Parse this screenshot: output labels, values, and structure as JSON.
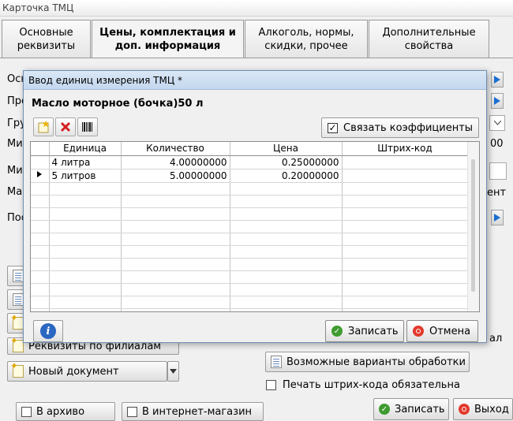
{
  "window": {
    "title": "Карточка ТМЦ"
  },
  "tabs": [
    {
      "label": "Основные\nреквизиты"
    },
    {
      "label": "Цены, комплектация и\nдоп.  информация"
    },
    {
      "label": "Алкоголь, нормы,\nскидки, прочее"
    },
    {
      "label": "Дополнительные\nсвойства"
    }
  ],
  "background": {
    "fragments": [
      "Осн",
      "Про",
      "Гру",
      "Ми",
      "Ми",
      "Ма",
      "Пос"
    ],
    "right_fragments": [
      "ент",
      "00",
      "ал"
    ],
    "buttons": {
      "branch_requisites": "Реквизиты по филиалам",
      "new_document": "Новый документ",
      "processing_variants": "Возможные варианты обработки",
      "archive": "В архиво",
      "online_store": "В интернет-магазин",
      "save": "Записать",
      "exit": "Выход"
    },
    "barcode_required": "Печать штрих-кода обязательна"
  },
  "modal": {
    "title": "Ввод единиц измерения ТМЦ *",
    "heading": "Масло моторное (бочка)50 л",
    "link_coefficients": {
      "label": "Связать коэффициенты",
      "checked": true
    },
    "columns": [
      "Единица",
      "Количество",
      "Цена",
      "Штрих-код"
    ],
    "rows": [
      {
        "unit": "4 литра",
        "qty": "4.00000000",
        "price": "0.25000000",
        "barcode": "",
        "current": false
      },
      {
        "unit": "5 литров",
        "qty": "5.00000000",
        "price": "0.20000000",
        "barcode": "",
        "current": true
      }
    ],
    "save_label": "Записать",
    "cancel_label": "Отмена"
  },
  "colors": {
    "accent": "#1b6fd1",
    "ok": "#3e9b2f",
    "cancel": "#e2392b",
    "delete": "#d42020"
  }
}
